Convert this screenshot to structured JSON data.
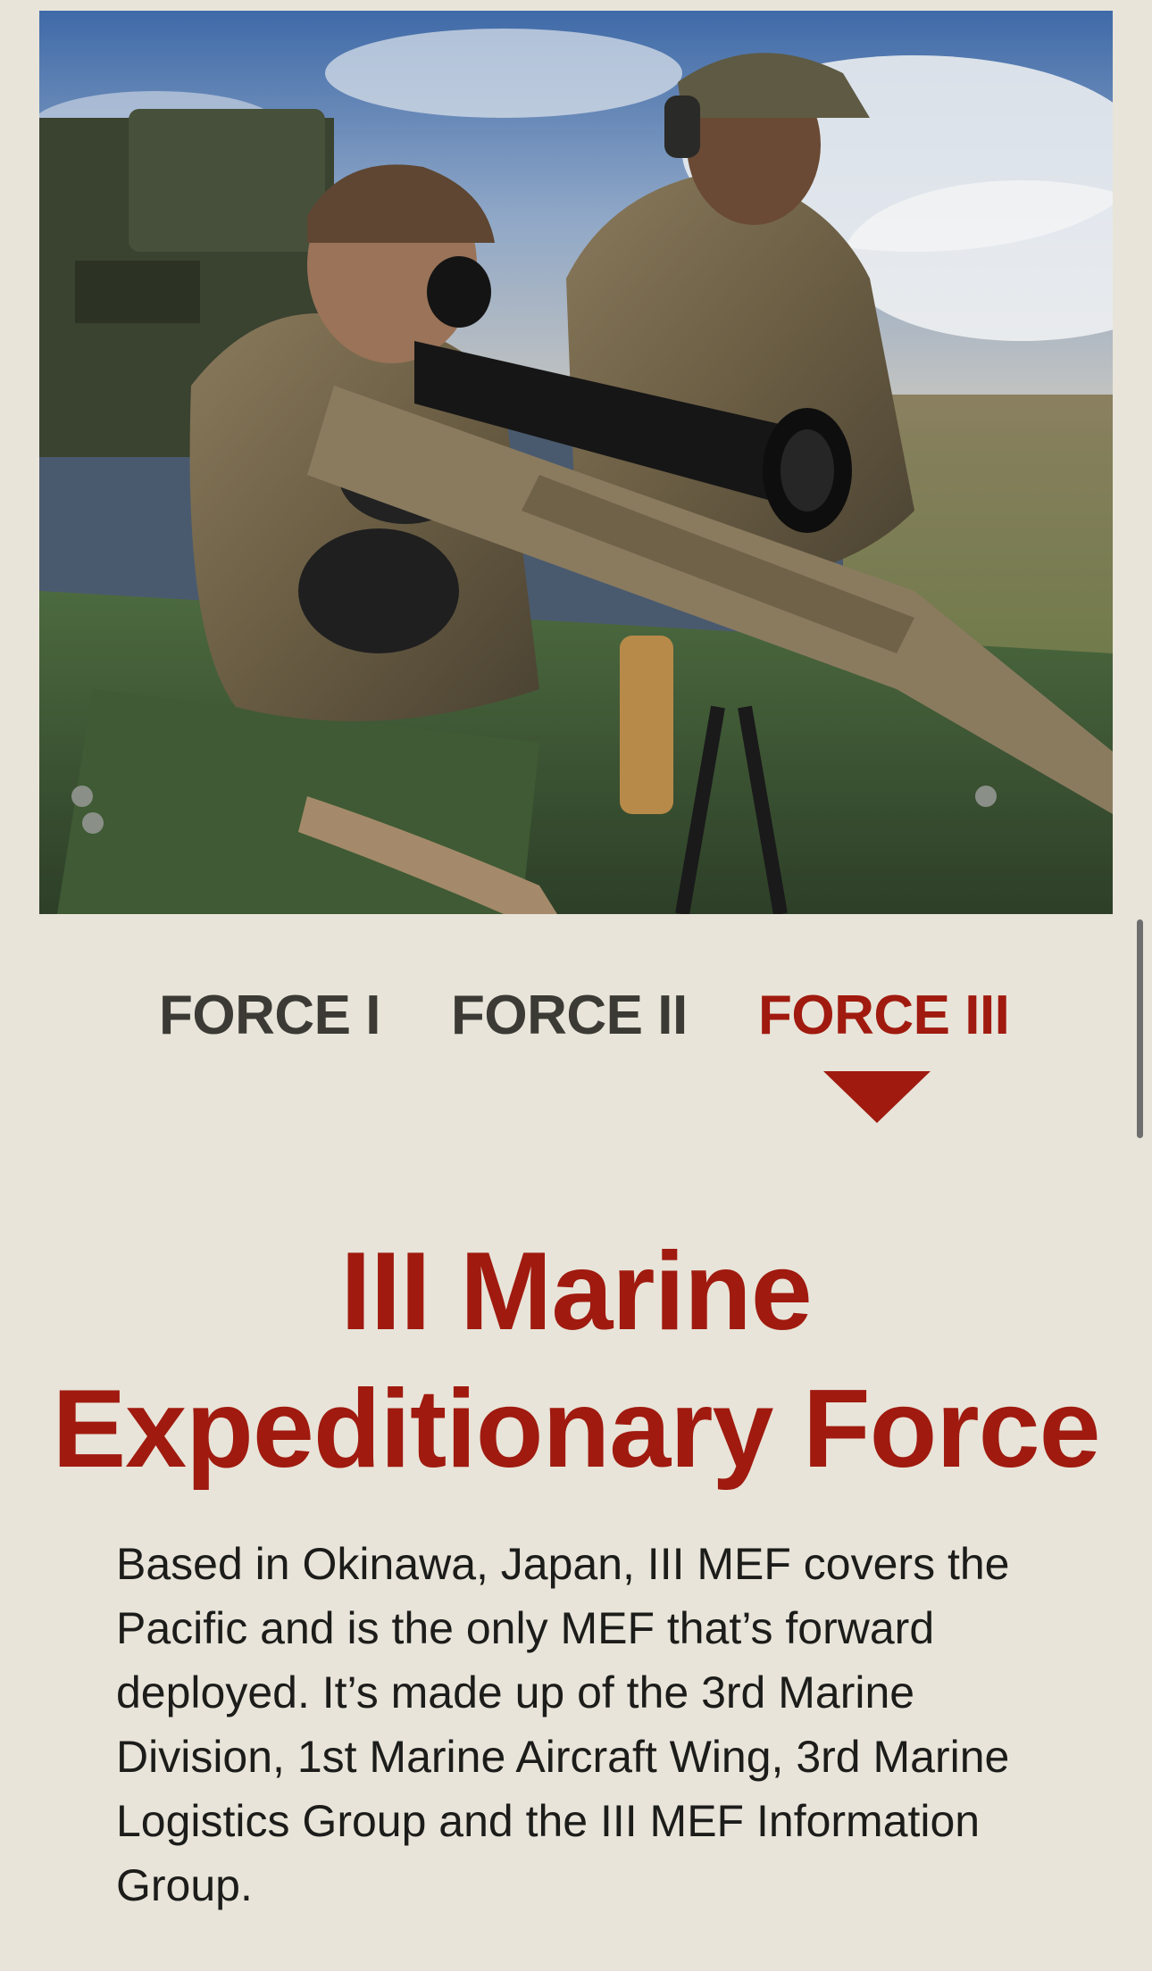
{
  "hero": {
    "image_alt": "Marine snipers aiming a scoped rifle from atop an armored vehicle"
  },
  "tabs": [
    {
      "label": "FORCE I",
      "active": false
    },
    {
      "label": "FORCE II",
      "active": false
    },
    {
      "label": "FORCE III",
      "active": true
    }
  ],
  "content": {
    "title_line1": "III Marine",
    "title_line2": "Expeditionary Force",
    "body": "Based in Okinawa, Japan, III MEF covers the Pacific and is the only MEF that’s forward deployed. It’s made up of the 3rd Marine Division, 1st Marine Aircraft Wing, 3rd Marine Logistics Group and the III MEF Information Group."
  },
  "colors": {
    "background": "#e8e4d9",
    "accent": "#a01a0f",
    "tab_inactive": "#3b3a35",
    "text": "#1c1c1a"
  }
}
